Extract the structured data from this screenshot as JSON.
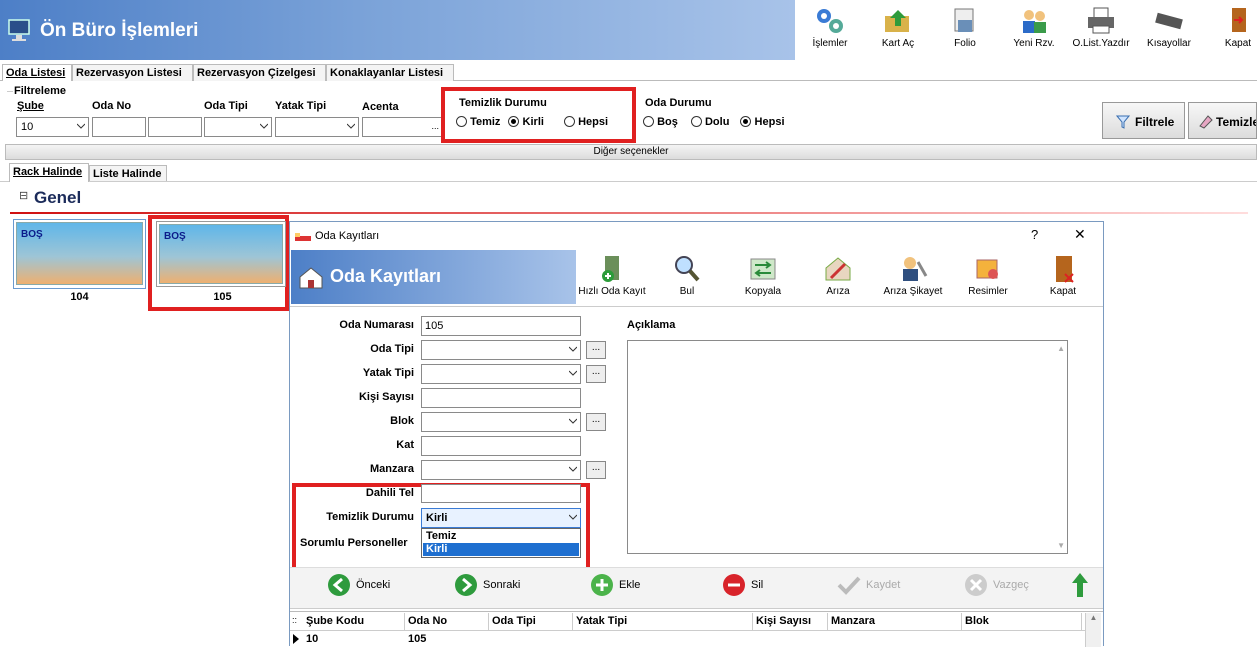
{
  "app": {
    "title": "Ön Büro İşlemleri"
  },
  "toolbar": [
    {
      "label": "İşlemler",
      "icon": "gears-icon"
    },
    {
      "label": "Kart Aç",
      "icon": "card-open-icon"
    },
    {
      "label": "Folio",
      "icon": "folio-icon"
    },
    {
      "label": "Yeni Rzv.",
      "icon": "new-reservation-icon"
    },
    {
      "label": "O.List.Yazdır",
      "icon": "printer-icon"
    },
    {
      "label": "Kısayollar",
      "icon": "keyboard-icon"
    },
    {
      "label": "Kapat",
      "icon": "exit-door-icon"
    }
  ],
  "tabs": [
    "Oda Listesi",
    "Rezervasyon Listesi",
    "Rezervasyon Çizelgesi",
    "Konaklayanlar Listesi"
  ],
  "filter": {
    "group_label": "Filtreleme",
    "sube_label": "Şube",
    "sube_value": "10",
    "oda_no_label": "Oda No",
    "oda_tipi_label": "Oda Tipi",
    "yatak_tipi_label": "Yatak Tipi",
    "acenta_label": "Acenta",
    "acenta_btn": "...",
    "temizlik": {
      "label": "Temizlik Durumu",
      "options": [
        "Temiz",
        "Kirli",
        "Hepsi"
      ],
      "selected": "Kirli"
    },
    "oda_durumu": {
      "label": "Oda Durumu",
      "options": [
        "Boş",
        "Dolu",
        "Hepsi"
      ],
      "selected": "Hepsi"
    },
    "filtrele_btn": "Filtrele",
    "temizle_btn": "Temizle",
    "more": "Diğer seçenekler"
  },
  "view_tabs": [
    "Rack Halinde",
    "Liste Halinde"
  ],
  "group": {
    "expander": "⊟",
    "name": "Genel"
  },
  "rooms": [
    {
      "status": "BOŞ",
      "number": "104"
    },
    {
      "status": "BOŞ",
      "number": "105"
    }
  ],
  "dialog": {
    "window_title": "Oda Kayıtları",
    "help": "?",
    "close": "✕",
    "banner_title": "Oda Kayıtları",
    "toolbar": [
      {
        "label": "Hızlı Oda Kayıt",
        "icon": "quick-room-add-icon"
      },
      {
        "label": "Bul",
        "icon": "magnifier-icon"
      },
      {
        "label": "Kopyala",
        "icon": "copy-arrows-icon"
      },
      {
        "label": "Arıza",
        "icon": "fault-house-icon"
      },
      {
        "label": "Arıza Şikayet",
        "icon": "complaint-person-icon"
      },
      {
        "label": "Resimler",
        "icon": "pictures-icon"
      },
      {
        "label": "Kapat",
        "icon": "exit-door-icon"
      }
    ],
    "fields": {
      "oda_numarasi": {
        "label": "Oda Numarası",
        "value": "105"
      },
      "oda_tipi": {
        "label": "Oda Tipi",
        "value": ""
      },
      "yatak_tipi": {
        "label": "Yatak Tipi",
        "value": ""
      },
      "kisi_sayisi": {
        "label": "Kişi Sayısı",
        "value": ""
      },
      "blok": {
        "label": "Blok",
        "value": ""
      },
      "kat": {
        "label": "Kat",
        "value": ""
      },
      "manzara": {
        "label": "Manzara",
        "value": ""
      },
      "dahili_tel": {
        "label": "Dahili Tel",
        "value": ""
      },
      "temizlik_durumu": {
        "label": "Temizlik Durumu",
        "value": "Kirli",
        "options": [
          "Temiz",
          "Kirli"
        ],
        "highlighted": "Kirli"
      },
      "sorumlu": {
        "label": "Sorumlu Personeller"
      }
    },
    "ellipsis": "...",
    "aciklama_label": "Açıklama",
    "nav": {
      "prev": "Önceki",
      "next": "Sonraki",
      "add": "Ekle",
      "delete": "Sil",
      "save": "Kaydet",
      "cancel": "Vazgeç"
    },
    "grid": {
      "columns": [
        "Şube Kodu",
        "Oda No",
        "Oda Tipi",
        "Yatak Tipi",
        "Kişi Sayısı",
        "Manzara",
        "Blok"
      ],
      "rows": [
        [
          "10",
          "105",
          "",
          "",
          "",
          "",
          ""
        ]
      ]
    }
  },
  "colors": {
    "highlight_red": "#e02020",
    "banner_blue": "#4d7fc7",
    "selection_blue": "#1e6fd0"
  }
}
